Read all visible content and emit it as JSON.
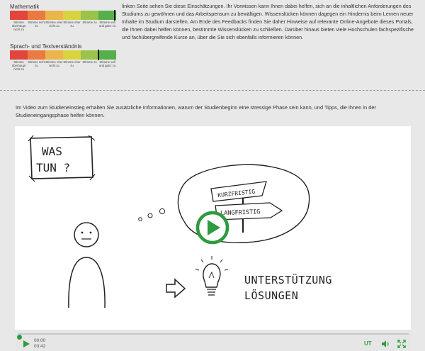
{
  "scales": [
    {
      "title": "Mathematik",
      "marker": 0.985,
      "labels": [
        "Stimme überhaupt nicht zu",
        "Stimme nicht zu",
        "Stimme eher nicht zu",
        "Stimme eher zu",
        "Stimme zu",
        "Stimme voll und ganz zu"
      ]
    },
    {
      "title": "Sprach- und Textverständnis",
      "marker": 0.83,
      "labels": [
        "Stimme überhaupt nicht zu",
        "Stimme nicht zu",
        "Stimme eher nicht zu",
        "Stimme eher zu",
        "Stimme zu",
        "Stimme voll und ganz zu"
      ]
    }
  ],
  "scale_colors": [
    "#e2453c",
    "#ea7a3f",
    "#eab54a",
    "#d9d33f",
    "#99c34a",
    "#56b04a"
  ],
  "description": "linken Seite sehen Sie diese Einschätzungen. Ihr Vorwissen kann Ihnen dabei helfen, sich an die inhaltlichen Anforderungen des Studiums zu gewöhnen und das Arbeitspensum zu bewältigen. Wissenslücken können dagegen ein Hindernis beim Lernen neuer Inhalte im Studium darstellen. Am Ende des Feedbacks finden Sie daher Hinweise auf relevante Online-Angebote dieses Portals, die Ihnen dabei helfen können, bestimmte Wissenslücken zu schließen. Darüber hinaus bieten viele Hochschulen fachspezifische und fachübergreifende Kurse an, über die Sie sich ebenfalls informieren können.",
  "intro": "Im Video zum Studieneinstieg erhalten Sie zusätzliche Informationen, warum der Studienbeginn eine stressige Phase sein kann, und Tipps, die Ihnen in der Studieneingangsphase helfen können.",
  "video": {
    "sign_line1": "WAS",
    "sign_line2": "TUN ?",
    "sign_short": "KURZFRISTIG",
    "sign_long": "LANGFRISTIG",
    "text_line1": "UNTERSTÜTZUNG",
    "text_line2": "LÖSUNGEN",
    "progress": 0.0
  },
  "controls": {
    "time_current": "00:00",
    "time_total": "03:42",
    "subtitles_label": "UT",
    "accent": "#2e9b3e",
    "icons": [
      "play-icon",
      "volume-icon",
      "fullscreen-icon"
    ]
  }
}
